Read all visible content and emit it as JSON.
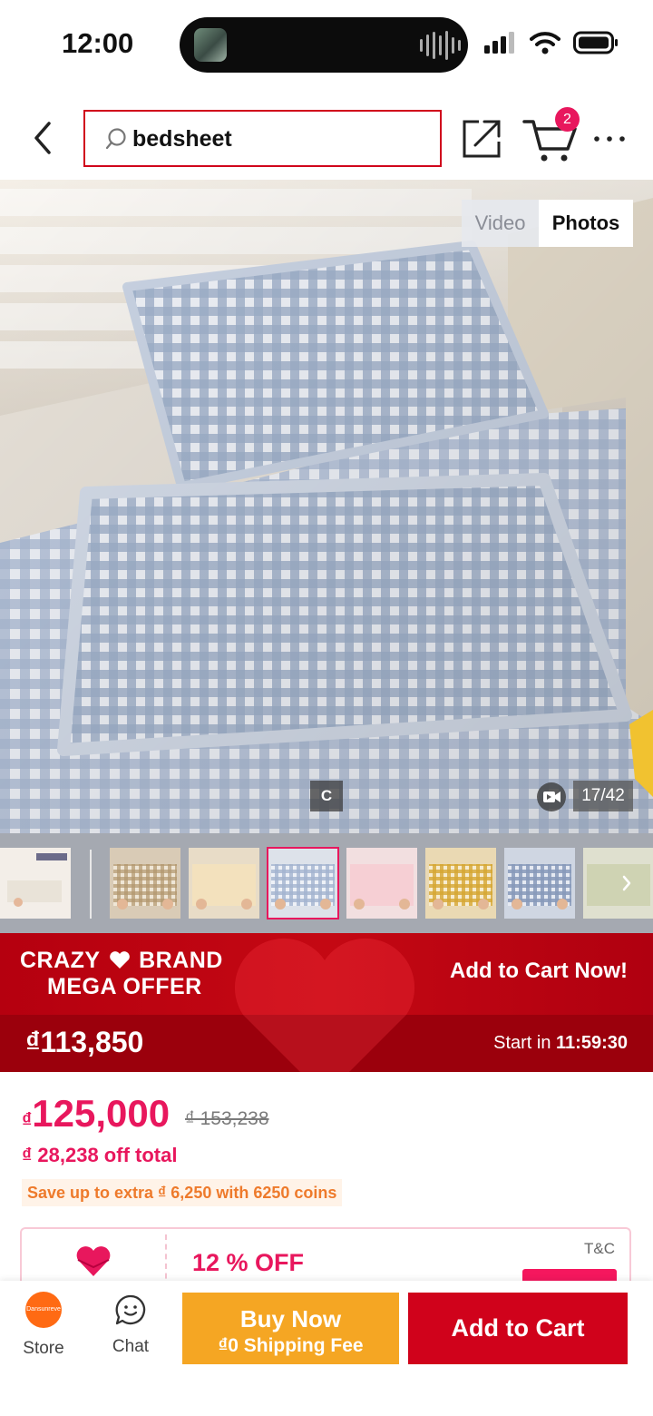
{
  "status_bar": {
    "time": "12:00"
  },
  "header": {
    "search_value": "bedsheet",
    "cart_count": "2"
  },
  "gallery": {
    "toggle_video": "Video",
    "toggle_photos": "Photos",
    "selected_tab": "Photos",
    "tag": "C",
    "counter": "17/42",
    "thumbnail_count": 8,
    "selected_thumbnail": 4
  },
  "flash_promo": {
    "title_line1": "CRAZY",
    "title_line1b": "BRAND",
    "title_line2": "MEGA OFFER",
    "cta": "Add to Cart Now!",
    "price": "₫113,850",
    "start_label": "Start in",
    "countdown": "11:59:30"
  },
  "pricing": {
    "currency": "₫",
    "price": "125,000",
    "original_price": "₫ 153,238",
    "discount_total": "₫ 28,238 off total",
    "coins_note": "Save up to extra ₫ 6,250 with 6250 coins"
  },
  "voucher": {
    "label": "12 % OFF",
    "terms": "T&C"
  },
  "bottom_bar": {
    "store_logo_text": "Dansunreve",
    "store_label": "Store",
    "chat_label": "Chat",
    "buy_now_label": "Buy Now",
    "buy_now_sub": "₫0 Shipping Fee",
    "add_to_cart_label": "Add to Cart"
  },
  "colors": {
    "brand_red": "#d0021b",
    "accent_pink": "#e8175d",
    "buy_now_orange": "#f5a623",
    "coins_orange": "#ee7a2b"
  }
}
